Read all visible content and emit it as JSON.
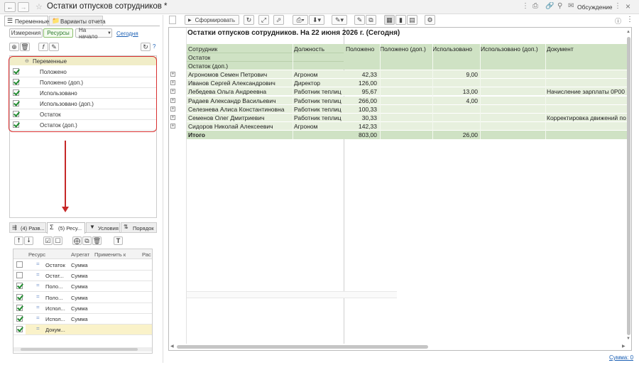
{
  "titlebar": {
    "title": "Остатки отпусков сотрудников *",
    "discussion": "Обсуждение"
  },
  "tabs": [
    {
      "label": "Переменные"
    },
    {
      "label": "Варианты отчета"
    }
  ],
  "subtabs": {
    "dimensions": "Измерения",
    "resources": "Ресурсы",
    "to_start": "На начало",
    "today": "Сегодня"
  },
  "tree": {
    "root": "Переменные",
    "items": [
      {
        "label": "Положено",
        "checked": true
      },
      {
        "label": "Положено (доп.)",
        "checked": true
      },
      {
        "label": "Использовано",
        "checked": true
      },
      {
        "label": "Использовано (доп.)",
        "checked": true
      },
      {
        "label": "Остаток",
        "checked": true
      },
      {
        "label": "Остаток (доп.)",
        "checked": true
      }
    ]
  },
  "bottom_tabs": [
    "(4) Разв...",
    "(5) Ресу...",
    "Условия",
    "Порядок"
  ],
  "res_table": {
    "headers": [
      "Ресурс",
      "Агрегат",
      "Применить к",
      "Рас"
    ],
    "rows": [
      {
        "name": "Остаток",
        "agg": "Сумма",
        "checked": false
      },
      {
        "name": "Остат...",
        "agg": "Сумма",
        "checked": false
      },
      {
        "name": "Поло...",
        "agg": "Сумма",
        "checked": true
      },
      {
        "name": "Поло...",
        "agg": "Сумма",
        "checked": true
      },
      {
        "name": "Испол...",
        "agg": "Сумма",
        "checked": true
      },
      {
        "name": "Испол...",
        "agg": "Сумма",
        "checked": true
      },
      {
        "name": "Докум...",
        "agg": "",
        "checked": true
      }
    ]
  },
  "toolbar": {
    "generate": "Сформировать"
  },
  "report": {
    "title": "Остатки отпусков сотрудников. На 22 июня 2026 г. (Сегодня)",
    "head_left": [
      "Сотрудник",
      "Остаток",
      "Остаток (доп.)"
    ],
    "head_pos": "Должность",
    "cols": [
      "Положено",
      "Положено (доп.)",
      "Использовано",
      "Использовано (доп.)",
      "Документ"
    ],
    "rows": [
      {
        "name": "Агрономов Семен Петрович",
        "pos": "Агроном",
        "c1": "42,33",
        "c3": "9,00",
        "doc": ""
      },
      {
        "name": "Иванов Сергей Александрович",
        "pos": "Директор",
        "c1": "126,00",
        "c3": "",
        "doc": ""
      },
      {
        "name": "Лебедева Ольга Андреевна",
        "pos": "Работник теплиц",
        "c1": "95,67",
        "c3": "13,00",
        "doc": "Начисление зарплаты 0Р00"
      },
      {
        "name": "Радаев Александр Васильевич",
        "pos": "Работник теплиц",
        "c1": "266,00",
        "c3": "4,00",
        "doc": ""
      },
      {
        "name": "Селезнева Алиса Константиновна",
        "pos": "Работник теплиц",
        "c1": "100,33",
        "c3": "",
        "doc": ""
      },
      {
        "name": "Семенов Олег Дмитриевич",
        "pos": "Работник теплиц",
        "c1": "30,33",
        "c3": "",
        "doc": "Корректировка движений по"
      },
      {
        "name": "Сидоров Николай Алексеевич",
        "pos": "Агроном",
        "c1": "142,33",
        "c3": "",
        "doc": ""
      }
    ],
    "total": {
      "label": "Итого",
      "c1": "803,00",
      "c3": "26,00"
    }
  },
  "footer": {
    "sum": "Сумма: 0"
  },
  "colors": {
    "header_green": "#cfe2c4",
    "row_green": "#e7f0de",
    "highlight": "#d93030",
    "arrow": "#c62828"
  }
}
